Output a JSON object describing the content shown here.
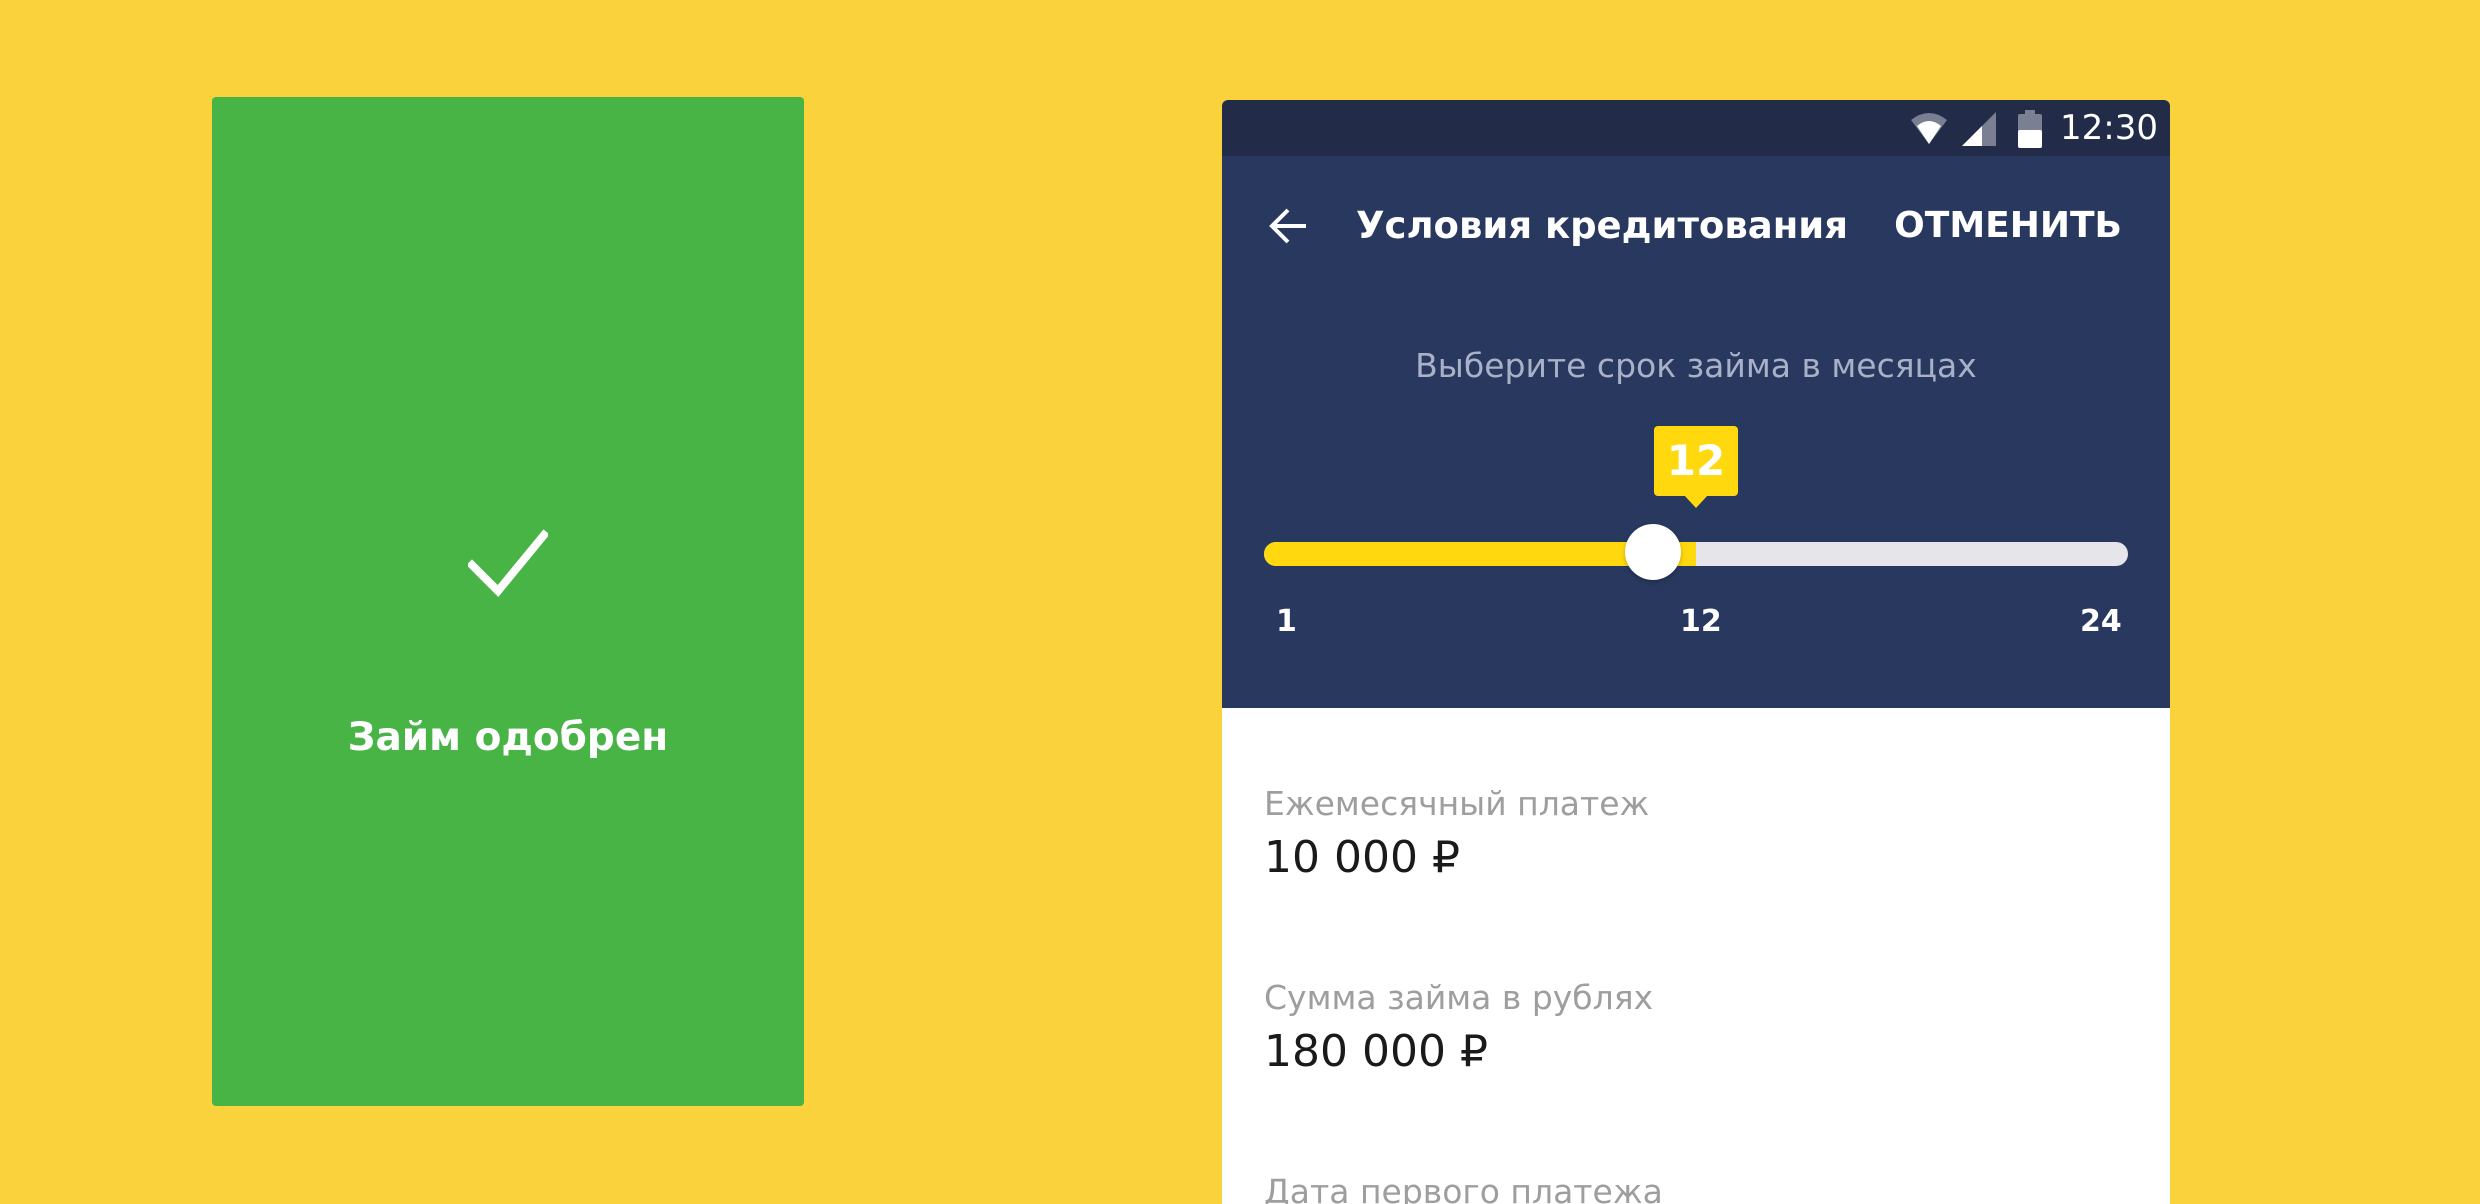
{
  "approved_card": {
    "text": "Займ одобрен",
    "icon": "check-icon",
    "color": "#48B446"
  },
  "status_bar": {
    "time": "12:30",
    "icons": [
      "wifi-icon",
      "signal-icon",
      "battery-icon"
    ]
  },
  "header": {
    "back_icon": "arrow-left-icon",
    "title": "Условия кредитования",
    "cancel_label": "ОТМЕНИТЬ"
  },
  "slider": {
    "prompt": "Выберите срок займа в месяцах",
    "value": "12",
    "min_label": "1",
    "mid_label": "12",
    "max_label": "24",
    "fill_fraction": 0.5
  },
  "fields": {
    "monthly_payment": {
      "label": "Ежемесячный платеж",
      "value": "10 000 ₽"
    },
    "loan_amount": {
      "label": "Сумма займа в рублях",
      "value": "180 000 ₽"
    },
    "first_payment_date": {
      "label": "Дата первого платежа"
    }
  },
  "colors": {
    "background": "#FAD23C",
    "status_bar": "#222C48",
    "header": "#29385F",
    "accent": "#FFD90D",
    "track": "#E6E6EA"
  }
}
